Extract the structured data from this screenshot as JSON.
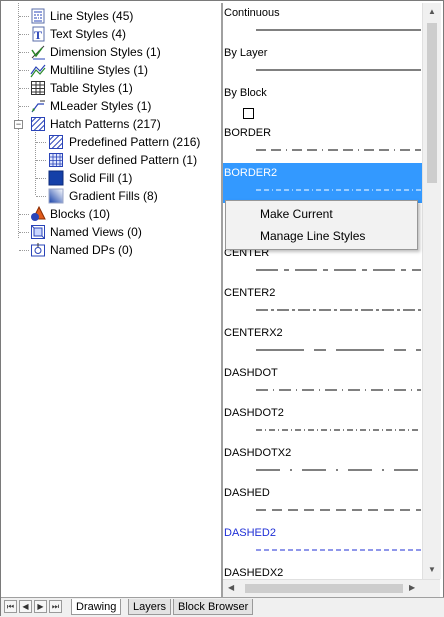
{
  "tree": {
    "items": [
      {
        "label": "Line Styles (45)",
        "icon": "line-styles-icon"
      },
      {
        "label": "Text Styles (4)",
        "icon": "text-styles-icon"
      },
      {
        "label": "Dimension Styles (1)",
        "icon": "dimension-styles-icon"
      },
      {
        "label": "Multiline Styles (1)",
        "icon": "multiline-styles-icon"
      },
      {
        "label": "Table Styles (1)",
        "icon": "table-styles-icon"
      },
      {
        "label": "MLeader Styles (1)",
        "icon": "mleader-styles-icon"
      },
      {
        "label": "Hatch Patterns (217)",
        "icon": "hatch-patterns-icon",
        "expander": "−"
      },
      {
        "label": "Predefined Pattern (216)",
        "icon": "predefined-pattern-icon"
      },
      {
        "label": "User defined Pattern (1)",
        "icon": "user-defined-pattern-icon"
      },
      {
        "label": "Solid Fill (1)",
        "icon": "solid-fill-icon"
      },
      {
        "label": "Gradient Fills (8)",
        "icon": "gradient-fills-icon"
      },
      {
        "label": "Blocks (10)",
        "icon": "blocks-icon"
      },
      {
        "label": "Named Views (0)",
        "icon": "named-views-icon"
      },
      {
        "label": "Named DPs (0)",
        "icon": "named-dps-icon"
      }
    ]
  },
  "line_styles": [
    {
      "name": "Continuous",
      "pattern": "solid"
    },
    {
      "name": "By Layer",
      "pattern": "solid"
    },
    {
      "name": "By Block",
      "pattern": "box"
    },
    {
      "name": "BORDER",
      "pattern": "border"
    },
    {
      "name": "BORDER2",
      "pattern": "border2",
      "selected": true
    },
    {
      "name": "",
      "pattern": "none"
    },
    {
      "name": "CENTER",
      "pattern": "center"
    },
    {
      "name": "CENTER2",
      "pattern": "center2"
    },
    {
      "name": "CENTERX2",
      "pattern": "centerx2"
    },
    {
      "name": "DASHDOT",
      "pattern": "dashdot"
    },
    {
      "name": "DASHDOT2",
      "pattern": "dashdot2"
    },
    {
      "name": "DASHDOTX2",
      "pattern": "dashdotx2"
    },
    {
      "name": "DASHED",
      "pattern": "dashed"
    },
    {
      "name": "DASHED2",
      "pattern": "dashed2",
      "blue": true
    },
    {
      "name": "DASHEDX2",
      "pattern": "dashedx2"
    }
  ],
  "context_menu": {
    "make_current": "Make Current",
    "manage_line_styles": "Manage Line Styles"
  },
  "tabs": {
    "drawing": "Drawing",
    "layers": "Layers",
    "block_browser": "Block Browser"
  },
  "nav": {
    "first": "⏮",
    "prev": "◀",
    "next": "▶",
    "last": "⏭"
  },
  "colors": {
    "selection": "#3399ff",
    "accent_blue": "#1f2fd6"
  }
}
